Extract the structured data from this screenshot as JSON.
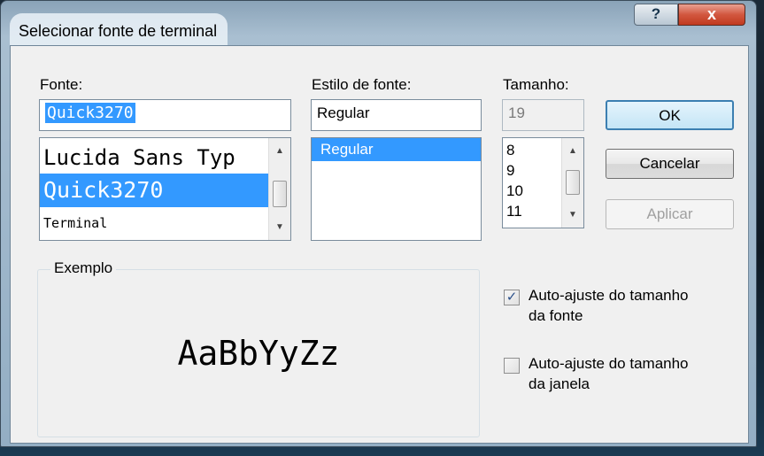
{
  "dialog": {
    "title": "Selecionar fonte de terminal",
    "help_label": "?",
    "close_label": "x"
  },
  "font": {
    "label": "Fonte:",
    "value": "Quick3270",
    "items": [
      "Lucida Sans Typ",
      "Quick3270",
      "Terminal"
    ],
    "selected_index": 1
  },
  "style": {
    "label": "Estilo de fonte:",
    "value": "Regular",
    "items": [
      "Regular"
    ]
  },
  "size": {
    "label": "Tamanho:",
    "value": "19",
    "items": [
      "8",
      "9",
      "10",
      "11"
    ]
  },
  "buttons": {
    "ok": "OK",
    "cancel": "Cancelar",
    "apply": "Aplicar"
  },
  "sample": {
    "label": "Exemplo",
    "text": "AaBbYyZz"
  },
  "options": {
    "auto_font_line1": "Auto-ajuste do tamanho",
    "auto_font_line2": "da fonte",
    "auto_font_checked": true,
    "auto_window_line1": "Auto-ajuste do tamanho",
    "auto_window_line2": "da janela",
    "auto_window_checked": false
  },
  "colors": {
    "selection": "#3399ff",
    "close_button": "#c13a1f"
  }
}
